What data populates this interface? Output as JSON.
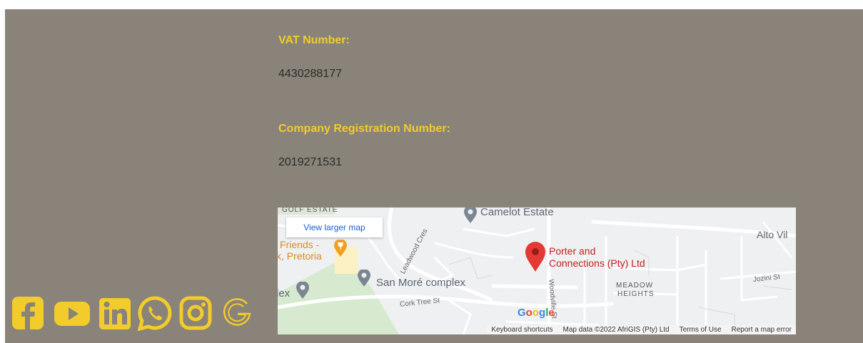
{
  "vat": {
    "label": "VAT Number:",
    "value": "4430288177"
  },
  "registration": {
    "label": "Company Registration Number:",
    "value": "2019271531"
  },
  "map": {
    "view_larger": "View larger map",
    "labels": {
      "golf_estate": "GOLF ESTATE",
      "camelot": "Camelot Estate",
      "alto": "Alto Vil",
      "friends_1": "Friends -",
      "friends_2": "k, Pretoria",
      "san_more": "San Moré complex",
      "lex": "lex",
      "cork_tree": "Cork Tree St",
      "leadwood": "Leadwood Cres",
      "woodville": "Woodville St",
      "meadow_1": "MEADOW",
      "meadow_2": "HEIGHTS",
      "jozini": "Jozini St",
      "porter_1": "Porter and",
      "porter_2": "Connections (Pty) Ltd",
      "google": "Google"
    },
    "attribution": {
      "shortcuts": "Keyboard shortcuts",
      "data": "Map data ©2022 AfriGIS (Pty) Ltd",
      "terms": "Terms of Use",
      "report": "Report a map error"
    }
  },
  "social_icons": [
    "facebook-icon",
    "youtube-icon",
    "linkedin-icon",
    "whatsapp-icon",
    "instagram-icon",
    "google-icon"
  ],
  "colors": {
    "panel": "#898379",
    "accent": "#f2cc2b",
    "text": "#2b2b2b",
    "pin": "#e53935",
    "map_link": "#1a5fd0"
  }
}
